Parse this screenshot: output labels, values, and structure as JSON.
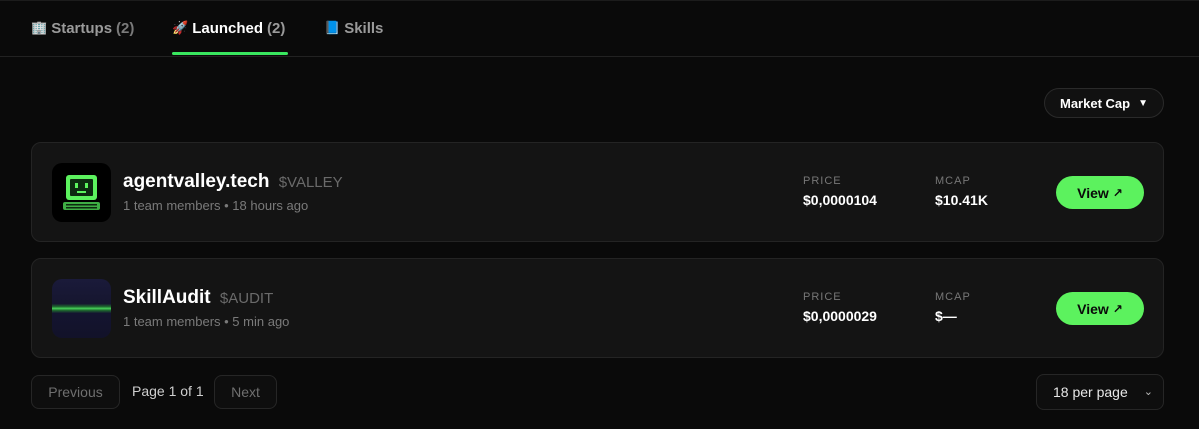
{
  "tabs": [
    {
      "icon": "🏢",
      "label": "Startups",
      "count": "(2)",
      "active": false
    },
    {
      "icon": "🚀",
      "label": "Launched",
      "count": "(2)",
      "active": true
    },
    {
      "icon": "📘",
      "label": "Skills",
      "count": "",
      "active": false
    }
  ],
  "sort": {
    "label": "Market Cap",
    "caret": "▼"
  },
  "stat_labels": {
    "price": "PRICE",
    "mcap": "MCAP"
  },
  "projects": [
    {
      "name": "agentvalley.tech",
      "ticker": "$VALLEY",
      "meta": "1 team members • 18 hours ago",
      "price": "$0,0000104",
      "mcap": "$10.41K",
      "view_label": "View",
      "view_arrow": "↗",
      "logo_icon": "computer-icon"
    },
    {
      "name": "SkillAudit",
      "ticker": "$AUDIT",
      "meta": "1 team members • 5 min ago",
      "price": "$0,0000029",
      "mcap": "$—",
      "view_label": "View",
      "view_arrow": "↗",
      "logo_icon": "gradient-line-logo"
    }
  ],
  "pagination": {
    "previous": "Previous",
    "indicator": "Page 1 of 1",
    "next": "Next",
    "per_page": "18 per page",
    "per_page_chevron": "⌄"
  },
  "colors": {
    "accent": "#5cf25e",
    "underline": "#39e75f",
    "background": "#0a0a0a"
  }
}
